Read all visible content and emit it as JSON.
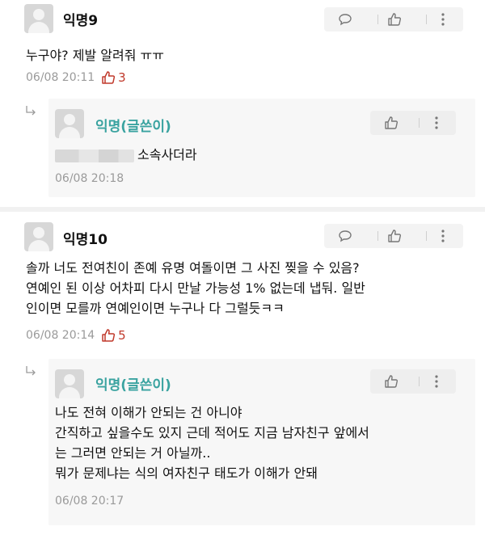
{
  "comments": [
    {
      "author": "익명9",
      "lines": [
        "누구야? 제발 알려줘 ㅠㅠ"
      ],
      "date": "06/08 20:11",
      "votes": "3",
      "replies": [
        {
          "author": "익명(글쓴이)",
          "redacted": true,
          "lines": [
            "소속사더라"
          ],
          "date": "06/08 20:18"
        }
      ]
    },
    {
      "author": "익명10",
      "lines": [
        "솔까 너도 전여친이 존예 유명 여돌이면 그 사진 찢을 수 있음?",
        "연예인 된 이상 어차피 다시 만날 가능성 1% 없는데 냅둬. 일반",
        "인이면 모를까 연예인이면 누구나 다 그럴듯ㅋㅋ"
      ],
      "date": "06/08 20:14",
      "votes": "5",
      "replies": [
        {
          "author": "익명(글쓴이)",
          "lines": [
            "나도 전혀 이해가 안되는 건 아니야",
            "간직하고 싶을수도 있지 근데 적어도 지금 남자친구 앞에서",
            "는 그러면 안되는 거 아닐까..",
            "뭐가 문제냐는 식의 여자친구 태도가 이해가 안돼"
          ],
          "date": "06/08 20:17"
        }
      ]
    }
  ],
  "icons": {
    "reply": "speech-bubble-icon",
    "like": "thumbs-up-icon",
    "more": "more-vertical-icon",
    "vote": "thumbs-up-outline-icon",
    "reply_arrow": "reply-arrow-icon"
  },
  "colors": {
    "op_name": "#3aa3a0",
    "vote": "#c0392b",
    "meta": "#9a9a9a",
    "action_bg": "#f3f3f3",
    "reply_bg": "#f7f7f7"
  }
}
